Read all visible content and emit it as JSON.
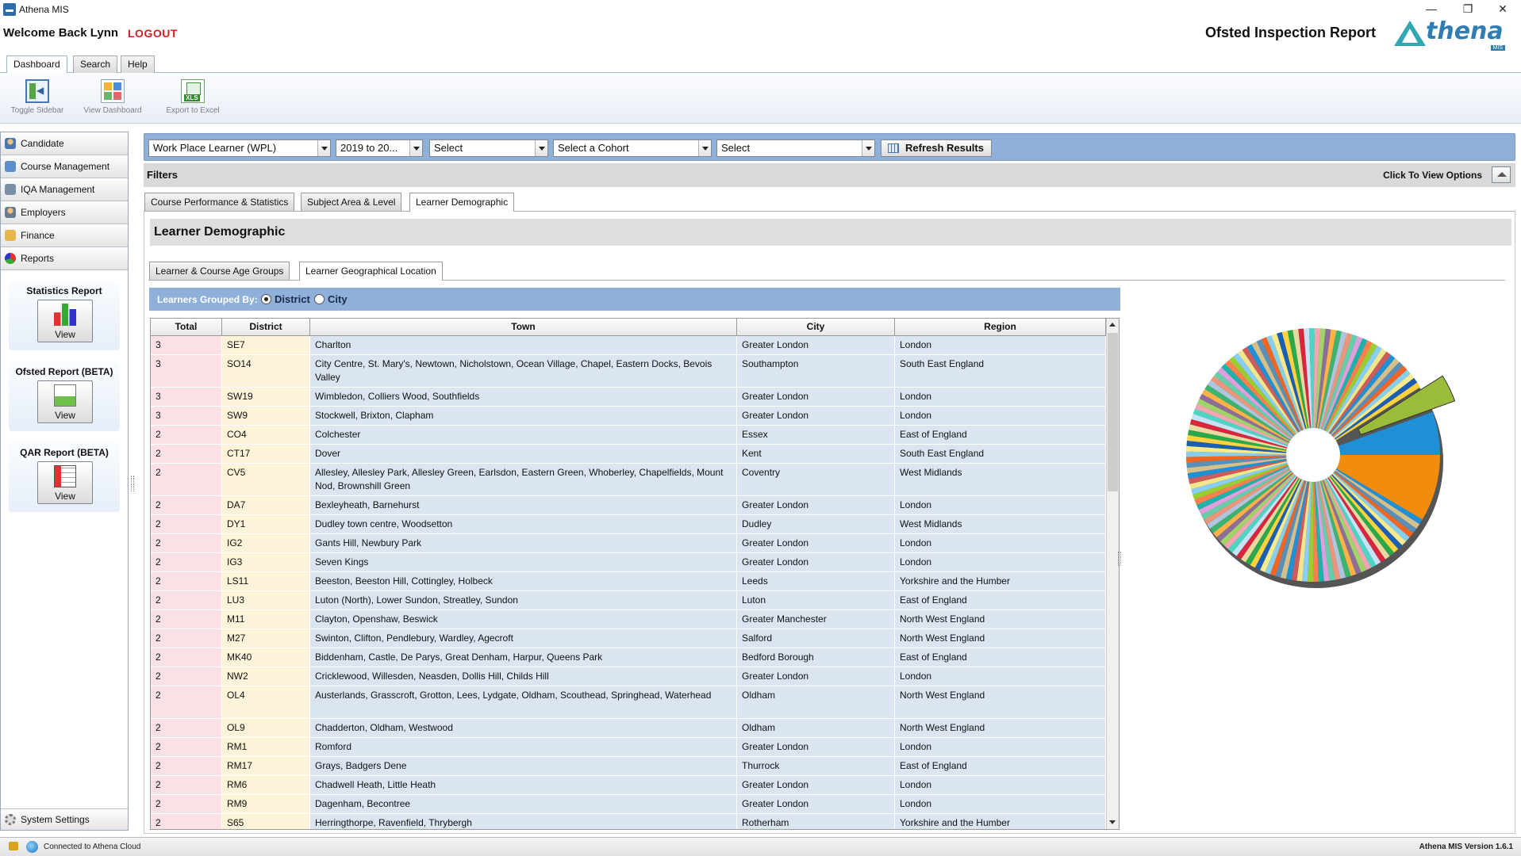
{
  "window": {
    "title": "Athena MIS",
    "minimize": "—",
    "restore": "❐",
    "close": "✕"
  },
  "header": {
    "welcome": "Welcome Back Lynn",
    "logout": "LOGOUT",
    "report_title": "Ofsted Inspection Report",
    "logo_text": "thena",
    "logo_sub": "MIS"
  },
  "top_tabs": [
    "Dashboard",
    "Search",
    "Help"
  ],
  "toolbar": {
    "toggle_sidebar": "Toggle Sidebar",
    "view_dashboard": "View Dashboard",
    "export_excel": "Export to Excel"
  },
  "sidebar": {
    "items": [
      "Candidate",
      "Course Management",
      "IQA Management",
      "Employers",
      "Finance",
      "Reports"
    ],
    "reports": [
      {
        "title": "Statistics Report",
        "button": "View"
      },
      {
        "title": "Ofsted Report (BETA)",
        "button": "View"
      },
      {
        "title": "QAR Report (BETA)",
        "button": "View"
      }
    ],
    "system_settings": "System Settings"
  },
  "filterbar": {
    "learner_type": "Work Place Learner (WPL)",
    "year": "2019 to 20...",
    "select1": "Select",
    "cohort": "Select a Cohort",
    "select2": "Select",
    "refresh": "Refresh Results"
  },
  "filters": {
    "title": "Filters",
    "view_options": "Click To View Options"
  },
  "section_tabs": [
    "Course Performance & Statistics",
    "Subject Area & Level",
    "Learner Demographic"
  ],
  "panel": {
    "title": "Learner Demographic",
    "sub_tabs": [
      "Learner & Course Age Groups",
      "Learner Geographical Location"
    ],
    "grouped_by_label": "Learners Grouped By:",
    "option_district": "District",
    "option_city": "City"
  },
  "table": {
    "columns": [
      "Total",
      "District",
      "Town",
      "City",
      "Region"
    ],
    "rows": [
      {
        "total": "3",
        "district": "SE7",
        "town": "Charlton",
        "city": "Greater London",
        "region": "London"
      },
      {
        "total": "3",
        "district": "SO14",
        "town": "City Centre, St. Mary's, Newtown, Nicholstown, Ocean Village, Chapel, Eastern Docks, Bevois Valley",
        "city": "Southampton",
        "region": "South East England"
      },
      {
        "total": "3",
        "district": "SW19",
        "town": "Wimbledon, Colliers Wood, Southfields",
        "city": "Greater London",
        "region": "London"
      },
      {
        "total": "3",
        "district": "SW9",
        "town": "Stockwell, Brixton, Clapham",
        "city": "Greater London",
        "region": "London"
      },
      {
        "total": "2",
        "district": "CO4",
        "town": "Colchester",
        "city": "Essex",
        "region": "East of England"
      },
      {
        "total": "2",
        "district": "CT17",
        "town": "Dover",
        "city": "Kent",
        "region": "South East England"
      },
      {
        "total": "2",
        "district": "CV5",
        "town": "Allesley, Allesley Park, Allesley Green, Earlsdon, Eastern Green, Whoberley, Chapelfields, Mount Nod, Brownshill Green",
        "city": "Coventry",
        "region": "West Midlands"
      },
      {
        "total": "2",
        "district": "DA7",
        "town": "Bexleyheath, Barnehurst",
        "city": "Greater London",
        "region": "London"
      },
      {
        "total": "2",
        "district": "DY1",
        "town": "Dudley town centre, Woodsetton",
        "city": "Dudley",
        "region": "West Midlands"
      },
      {
        "total": "2",
        "district": "IG2",
        "town": "Gants Hill, Newbury Park",
        "city": "Greater London",
        "region": "London"
      },
      {
        "total": "2",
        "district": "IG3",
        "town": "Seven Kings",
        "city": "Greater London",
        "region": "London"
      },
      {
        "total": "2",
        "district": "LS11",
        "town": "Beeston, Beeston Hill, Cottingley, Holbeck",
        "city": "Leeds",
        "region": "Yorkshire and the Humber"
      },
      {
        "total": "2",
        "district": "LU3",
        "town": "Luton (North), Lower Sundon, Streatley, Sundon",
        "city": "Luton",
        "region": "East of England"
      },
      {
        "total": "2",
        "district": "M11",
        "town": "Clayton, Openshaw, Beswick",
        "city": "Greater Manchester",
        "region": "North West England"
      },
      {
        "total": "2",
        "district": "M27",
        "town": "Swinton, Clifton, Pendlebury, Wardley, Agecroft",
        "city": "Salford",
        "region": "North West England"
      },
      {
        "total": "2",
        "district": "MK40",
        "town": "Biddenham, Castle, De Parys, Great Denham, Harpur, Queens Park",
        "city": "Bedford Borough",
        "region": "East of England"
      },
      {
        "total": "2",
        "district": "NW2",
        "town": "Cricklewood, Willesden, Neasden, Dollis Hill, Childs Hill",
        "city": "Greater London",
        "region": "London"
      },
      {
        "total": "2",
        "district": "OL4",
        "town": "Austerlands, Grasscroft, Grotton, Lees, Lydgate, Oldham, Scouthead, Springhead, Waterhead",
        "city": "Oldham",
        "region": "North West England"
      },
      {
        "total": "2",
        "district": "OL9",
        "town": "Chadderton, Oldham, Westwood",
        "city": "Oldham",
        "region": "North West England"
      },
      {
        "total": "2",
        "district": "RM1",
        "town": "Romford",
        "city": "Greater London",
        "region": "London"
      },
      {
        "total": "2",
        "district": "RM17",
        "town": "Grays, Badgers Dene",
        "city": "Thurrock",
        "region": "East of England"
      },
      {
        "total": "2",
        "district": "RM6",
        "town": "Chadwell Heath, Little Heath",
        "city": "Greater London",
        "region": "London"
      },
      {
        "total": "2",
        "district": "RM9",
        "town": "Dagenham, Becontree",
        "city": "Greater London",
        "region": "London"
      },
      {
        "total": "2",
        "district": "S65",
        "town": "Herringthorpe, Ravenfield, Thrybergh",
        "city": "Rotherham",
        "region": "Yorkshire and the Humber"
      }
    ]
  },
  "chart_data": {
    "type": "pie",
    "style": "donut, 3D, one exploded slice (top-right)",
    "slices_note": "",
    "palette": [
      "#f28c0e",
      "#9bbb3b",
      "#1f8fd6",
      "#d4c08a",
      "#5a8fb8",
      "#f26522",
      "#87ceeb",
      "#f7e98e",
      "#1a5fb4",
      "#ffd23f",
      "#2ba84a",
      "#e8d9a0",
      "#d7263d",
      "#c6e2f5",
      "#4dd4c6",
      "#f4a6b0",
      "#a0d468",
      "#8d6e97",
      "#ffb347",
      "#3cb371",
      "#b0c4de",
      "#e9967a",
      "#66cdaa",
      "#dda0dd",
      "#20b2aa",
      "#ff7f50",
      "#9acd32",
      "#87cefa",
      "#f0e68c",
      "#cd5c5c"
    ]
  },
  "status": {
    "connection": "Connected to Athena Cloud",
    "version": "Athena MIS Version 1.6.1"
  }
}
